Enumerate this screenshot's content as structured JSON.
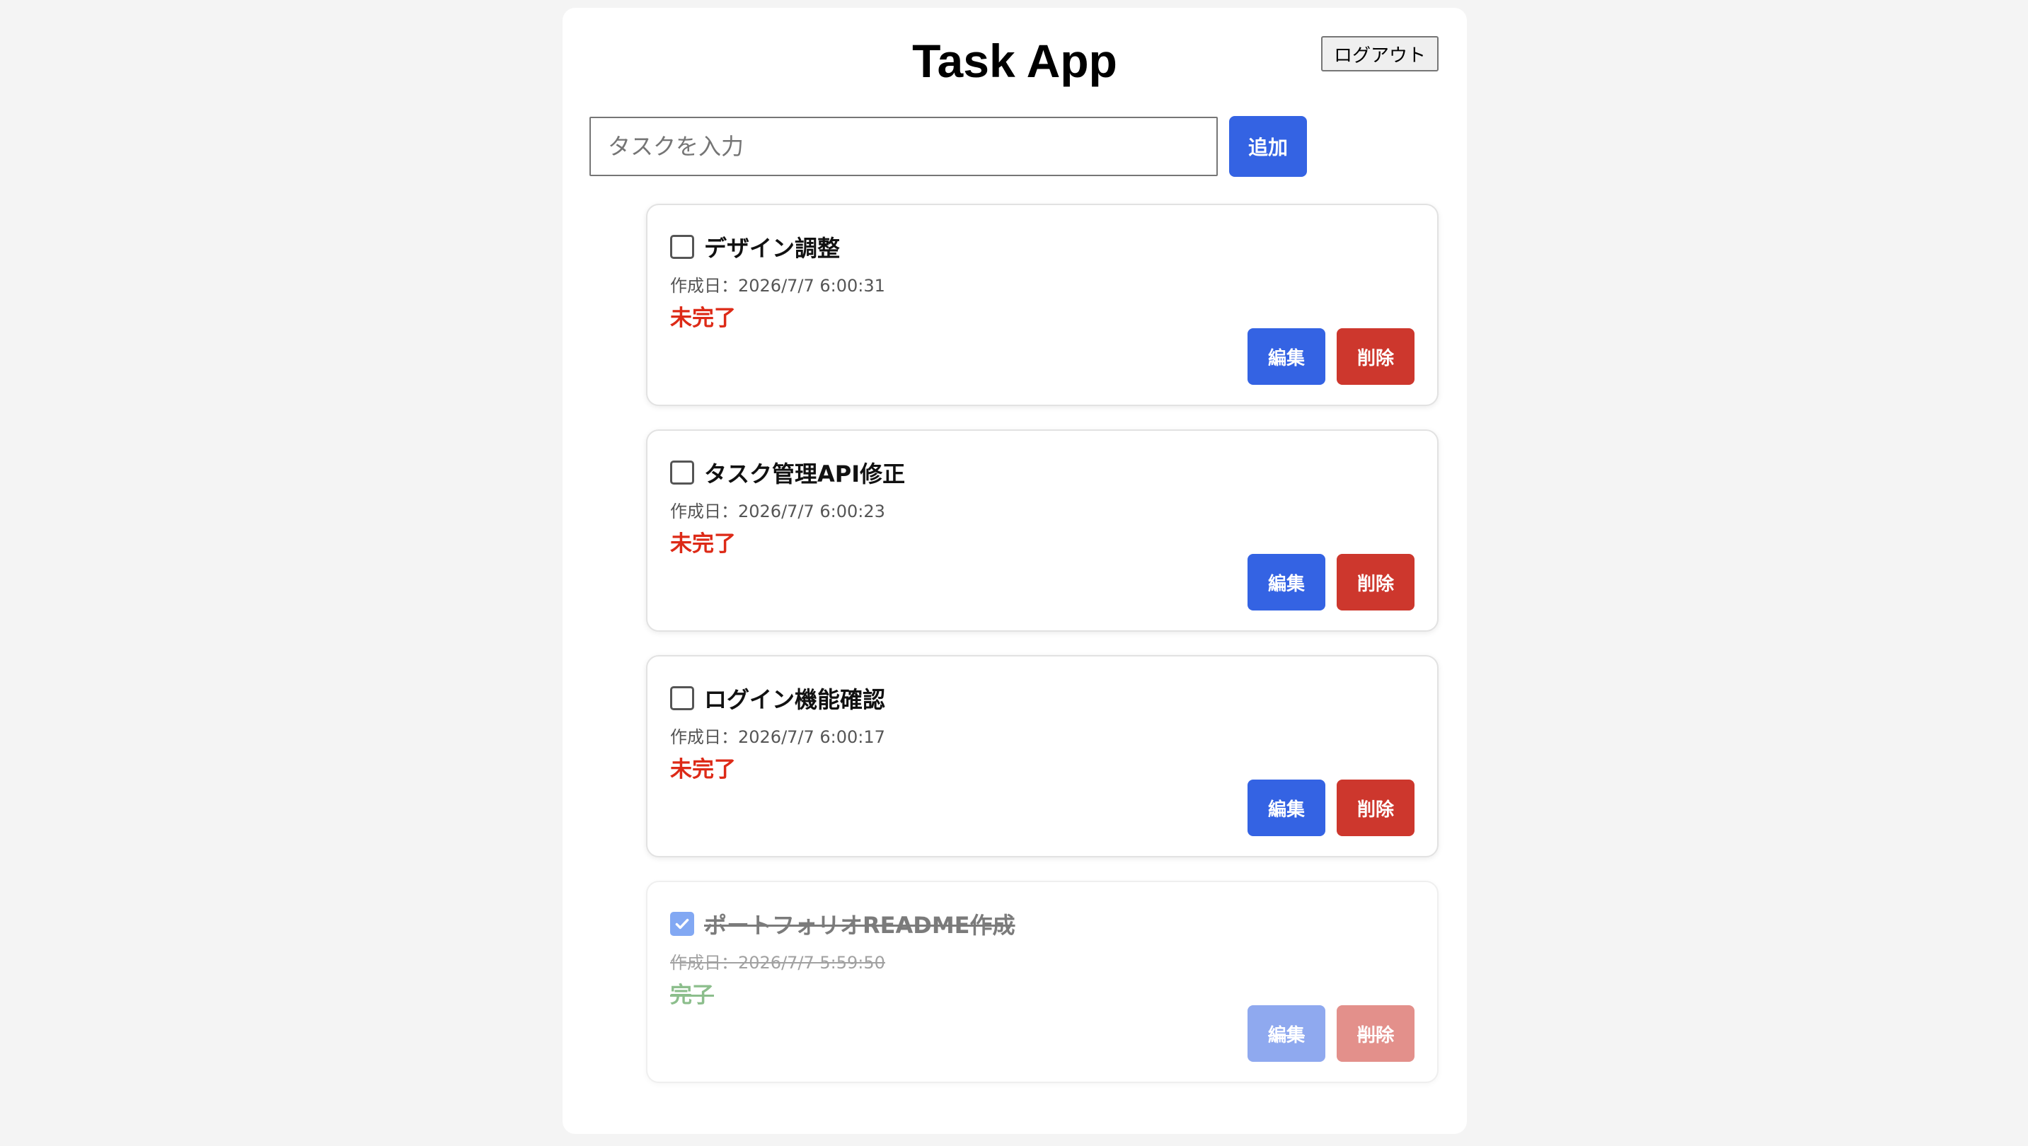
{
  "app": {
    "title": "Task App",
    "logout_label": "ログアウト"
  },
  "new_task": {
    "placeholder": "タスクを入力",
    "value": "",
    "add_label": "追加"
  },
  "tasks": [
    {
      "title": "デザイン調整",
      "date": "作成日：2026/7/7 6:00:31",
      "status": "未完了",
      "checked": false,
      "edit_label": "編集",
      "delete_label": "削除"
    },
    {
      "title": "タスク管理API修正",
      "date": "作成日：2026/7/7 6:00:23",
      "status": "未完了",
      "checked": false,
      "edit_label": "編集",
      "delete_label": "削除"
    },
    {
      "title": "ログイン機能確認",
      "date": "作成日：2026/7/7 6:00:17",
      "status": "未完了",
      "checked": false,
      "edit_label": "編集",
      "delete_label": "削除"
    },
    {
      "title": "ポートフォリオREADME作成",
      "date": "作成日：2026/7/7 5:59:50",
      "status": "完了",
      "checked": true,
      "edit_label": "編集",
      "delete_label": "削除"
    }
  ],
  "colors": {
    "primary": "#3463e3",
    "danger": "#cd372d",
    "status_incomplete": "#dd2a17",
    "status_complete": "#2f8a2f",
    "checkbox_checked": "#1d62ea"
  }
}
